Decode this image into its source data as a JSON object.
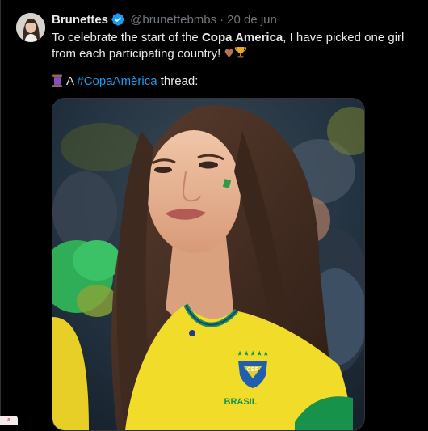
{
  "tweet": {
    "author_name": "Brunettes",
    "handle": "@brunettebmbs",
    "separator": "·",
    "date": "20 de jun",
    "text_part1": "To celebrate the start of the ",
    "text_bold": "Copa America",
    "text_part2": ", I have picked one girl from each participating country! ",
    "emoji_heart": "♥",
    "emoji_trophy": "🏆",
    "thread_prefix": "A ",
    "hashtag": "#CopaAmèrica",
    "thread_suffix": " thread:",
    "jersey_text": "BRASIL",
    "crest_text": "CBF"
  },
  "colors": {
    "background": "#000000",
    "text": "#e7e9ea",
    "muted": "#71767b",
    "link": "#1d9bf0",
    "verified": "#1d9bf0",
    "jersey_yellow": "#f2dc2a",
    "jersey_green": "#17924a"
  },
  "icons": {
    "verified": "verified-badge-icon",
    "thread": "spool-of-thread-icon",
    "heart": "brown-heart-icon",
    "trophy": "trophy-icon"
  },
  "corner": {
    "label": "a"
  }
}
